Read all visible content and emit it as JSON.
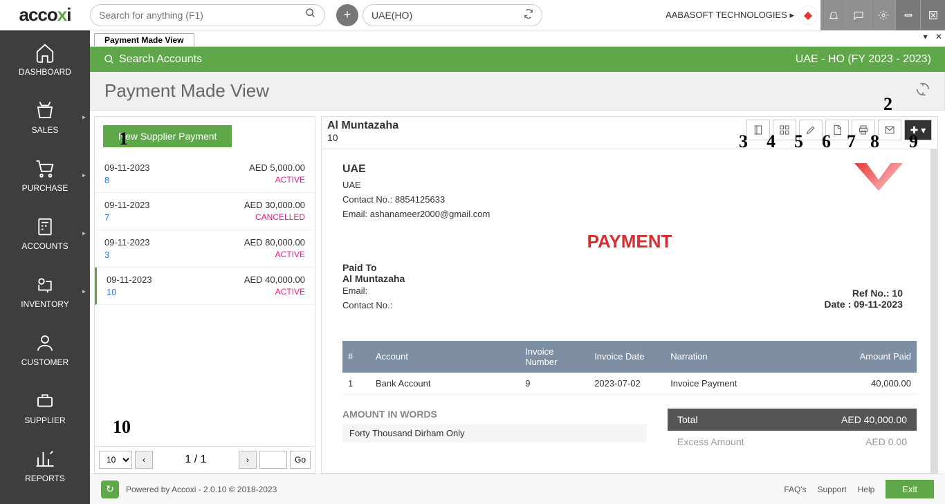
{
  "app": {
    "logo_left": "acco",
    "logo_x": "x",
    "logo_right": "i",
    "search_placeholder": "Search for anything (F1)",
    "entity": "UAE(HO)",
    "company": "AABASOFT TECHNOLOGIES"
  },
  "sidebar": {
    "items": [
      {
        "label": "DASHBOARD"
      },
      {
        "label": "SALES"
      },
      {
        "label": "PURCHASE"
      },
      {
        "label": "ACCOUNTS"
      },
      {
        "label": "INVENTORY"
      },
      {
        "label": "CUSTOMER"
      },
      {
        "label": "SUPPLIER"
      },
      {
        "label": "REPORTS"
      }
    ]
  },
  "tab": {
    "title": "Payment Made View"
  },
  "greenbar": {
    "search": "Search Accounts",
    "context": "UAE - HO (FY 2023 - 2023)"
  },
  "page": {
    "title": "Payment Made View"
  },
  "leftcol": {
    "new_btn": "New Supplier Payment",
    "pager_size": "10",
    "pager_info": "1 / 1",
    "go": "Go",
    "items": [
      {
        "date": "09-11-2023",
        "amt": "AED 5,000.00",
        "num": "8",
        "status": "ACTIVE"
      },
      {
        "date": "09-11-2023",
        "amt": "AED 30,000.00",
        "num": "7",
        "status": "CANCELLED"
      },
      {
        "date": "09-11-2023",
        "amt": "AED 80,000.00",
        "num": "3",
        "status": "ACTIVE"
      },
      {
        "date": "09-11-2023",
        "amt": "AED 40,000.00",
        "num": "10",
        "status": "ACTIVE"
      }
    ]
  },
  "header2": {
    "supplier": "Al Muntazaha",
    "ref": "10"
  },
  "doc": {
    "org": "UAE",
    "org_loc": "UAE",
    "contact_label": "Contact No.:",
    "contact": "8854125633",
    "email_label": "Email:",
    "email": "ashanameer2000@gmail.com",
    "title": "PAYMENT",
    "paidto_label": "Paid To",
    "paidto_name": "Al Muntazaha",
    "paidto_email": "Email:",
    "paidto_contact": "Contact No.:",
    "refno": "Ref No.: 10",
    "date": "Date : 09-11-2023",
    "th_num": "#",
    "th_acc": "Account",
    "th_inv": "Invoice Number",
    "th_invdate": "Invoice Date",
    "th_narr": "Narration",
    "th_amt": "Amount Paid",
    "row_num": "1",
    "row_acc": "Bank Account",
    "row_inv": "9",
    "row_invdate": "2023-07-02",
    "row_narr": "Invoice Payment",
    "row_amt": "40,000.00",
    "words_title": "AMOUNT IN WORDS",
    "words": "Forty Thousand Dirham Only",
    "total_label": "Total",
    "total_val": "AED 40,000.00",
    "excess_label": "Excess Amount",
    "excess_val": "AED 0.00"
  },
  "footer": {
    "text": "Powered by Accoxi - 2.0.10 © 2018-2023",
    "faq": "FAQ's",
    "support": "Support",
    "help": "Help",
    "exit": "Exit"
  },
  "overlays": {
    "n1": "1",
    "n2": "2",
    "n3": "3",
    "n4": "4",
    "n5": "5",
    "n6": "6",
    "n7": "7",
    "n8": "8",
    "n9": "9",
    "n10": "10"
  }
}
